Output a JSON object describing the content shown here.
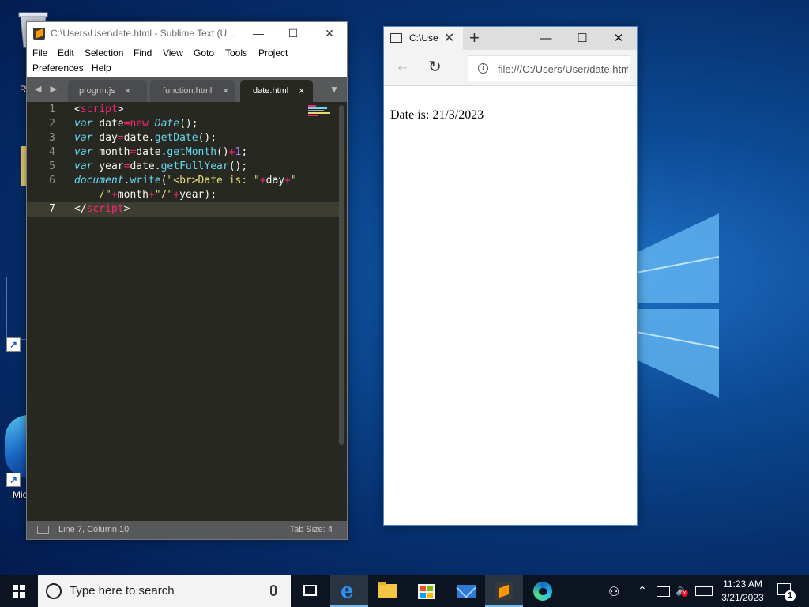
{
  "desktop": {
    "labels": [
      "R",
      "Mic"
    ],
    "shortcut_glyph": "↗"
  },
  "sublime": {
    "title": "C:\\Users\\User\\date.html - Sublime Text (U...",
    "caption": {
      "minimize": "—",
      "maximize": "☐",
      "close": "✕"
    },
    "menu": [
      "File",
      "Edit",
      "Selection",
      "Find",
      "View",
      "Goto",
      "Tools",
      "Project",
      "Preferences",
      "Help"
    ],
    "tab_nav": "◀ ▶",
    "tabs": [
      {
        "label": "progrm.js",
        "close": "×"
      },
      {
        "label": "function.html",
        "close": "×"
      },
      {
        "label": "date.html",
        "close": "×"
      }
    ],
    "tab_dropdown": "▼",
    "line_numbers": [
      "1",
      "2",
      "3",
      "4",
      "5",
      "6",
      "",
      "7"
    ],
    "code": {
      "l1_open": "<",
      "l1_tag": "script",
      "l1_close": ">",
      "var_kw": "var",
      "l2_name": " date",
      "l2_eq": "=",
      "l2_new": "new",
      "l2_cls": " Date",
      "l2_end": "();",
      "l3_name": " day",
      "l3_eq": "=",
      "l3_obj": "date.",
      "l3_fn": "getDate",
      "l3_end": "();",
      "l4_name": " month",
      "l4_eq": "=",
      "l4_obj": "date.",
      "l4_fn": "getMonth",
      "l4_paren": "()",
      "l4_plus": "+",
      "l4_num": "1",
      "l4_end": ";",
      "l5_name": " year",
      "l5_eq": "=",
      "l5_obj": "date.",
      "l5_fn": "getFullYear",
      "l5_end": "();",
      "l6_doc": "document",
      "l6_dot": ".",
      "l6_fn": "write",
      "l6_paren": "(",
      "l6_str1": "\"<br>Date is: \"",
      "l6_plus1": "+",
      "l6_day": "day",
      "l6_plus2": "+",
      "l6_str2": "\"",
      "l6b_str2": "    /\"",
      "l6b_plus3": "+",
      "l6b_month": "month",
      "l6b_plus4": "+",
      "l6b_str3": "\"/\"",
      "l6b_plus5": "+",
      "l6b_year": "year",
      "l6b_end": ");",
      "l7_open": "</",
      "l7_tag": "script",
      "l7_close": ">"
    },
    "status": {
      "position": "Line 7, Column 10",
      "tab_size": "Tab Size: 4"
    }
  },
  "browser": {
    "tab_title": "C:\\Users\\User\\date.html",
    "tab_close": "✕",
    "new_tab": "+",
    "caption": {
      "minimize": "—",
      "maximize": "☐",
      "close": "✕"
    },
    "back": "←",
    "refresh": "↻",
    "info": "i",
    "url": "file:///C:/Users/User/date.html",
    "page_text": "Date is: 21/3/2023"
  },
  "taskbar": {
    "search_placeholder": "Type here to search",
    "people_glyph": "⚇",
    "tray_chevron": "⌃",
    "volume_glyph": "🔈",
    "volume_mute": "x",
    "time": "11:23 AM",
    "date": "3/21/2023",
    "notification_count": "1"
  },
  "colors": {
    "editor_bg": "#272822",
    "keyword": "#66d9ef",
    "tag": "#f92672",
    "string": "#e6db74",
    "number": "#ae81ff",
    "taskbar": "#0d1421"
  }
}
